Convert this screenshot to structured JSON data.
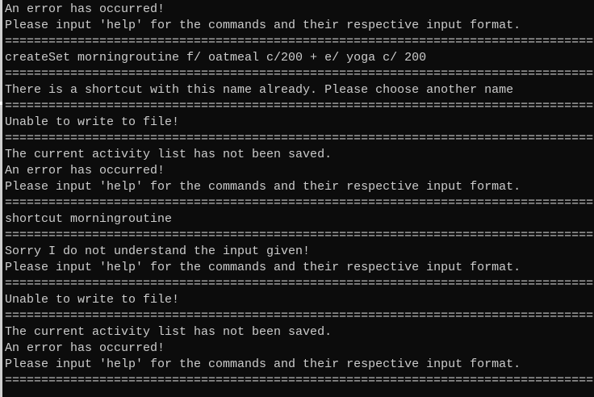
{
  "terminal": {
    "lines": [
      {
        "type": "text",
        "text": "An error has occurred!"
      },
      {
        "type": "text",
        "text": "Please input 'help' for the commands and their respective input format."
      },
      {
        "type": "sep"
      },
      {
        "type": "text",
        "text": "createSet morningroutine f/ oatmeal c/200 + e/ yoga c/ 200"
      },
      {
        "type": "sep"
      },
      {
        "type": "text",
        "text": "There is a shortcut with this name already. Please choose another name"
      },
      {
        "type": "sep"
      },
      {
        "type": "text",
        "text": "Unable to write to file!"
      },
      {
        "type": "sep"
      },
      {
        "type": "text",
        "text": "The current activity list has not been saved."
      },
      {
        "type": "text",
        "text": "An error has occurred!"
      },
      {
        "type": "text",
        "text": "Please input 'help' for the commands and their respective input format."
      },
      {
        "type": "sep"
      },
      {
        "type": "text",
        "text": "shortcut morningroutine"
      },
      {
        "type": "sep"
      },
      {
        "type": "text",
        "text": "Sorry I do not understand the input given!"
      },
      {
        "type": "text",
        "text": "Please input 'help' for the commands and their respective input format."
      },
      {
        "type": "sep"
      },
      {
        "type": "text",
        "text": "Unable to write to file!"
      },
      {
        "type": "sep"
      },
      {
        "type": "text",
        "text": "The current activity list has not been saved."
      },
      {
        "type": "text",
        "text": "An error has occurred!"
      },
      {
        "type": "text",
        "text": "Please input 'help' for the commands and their respective input format."
      },
      {
        "type": "sep"
      }
    ],
    "separator_text": "===================================================================================================="
  }
}
